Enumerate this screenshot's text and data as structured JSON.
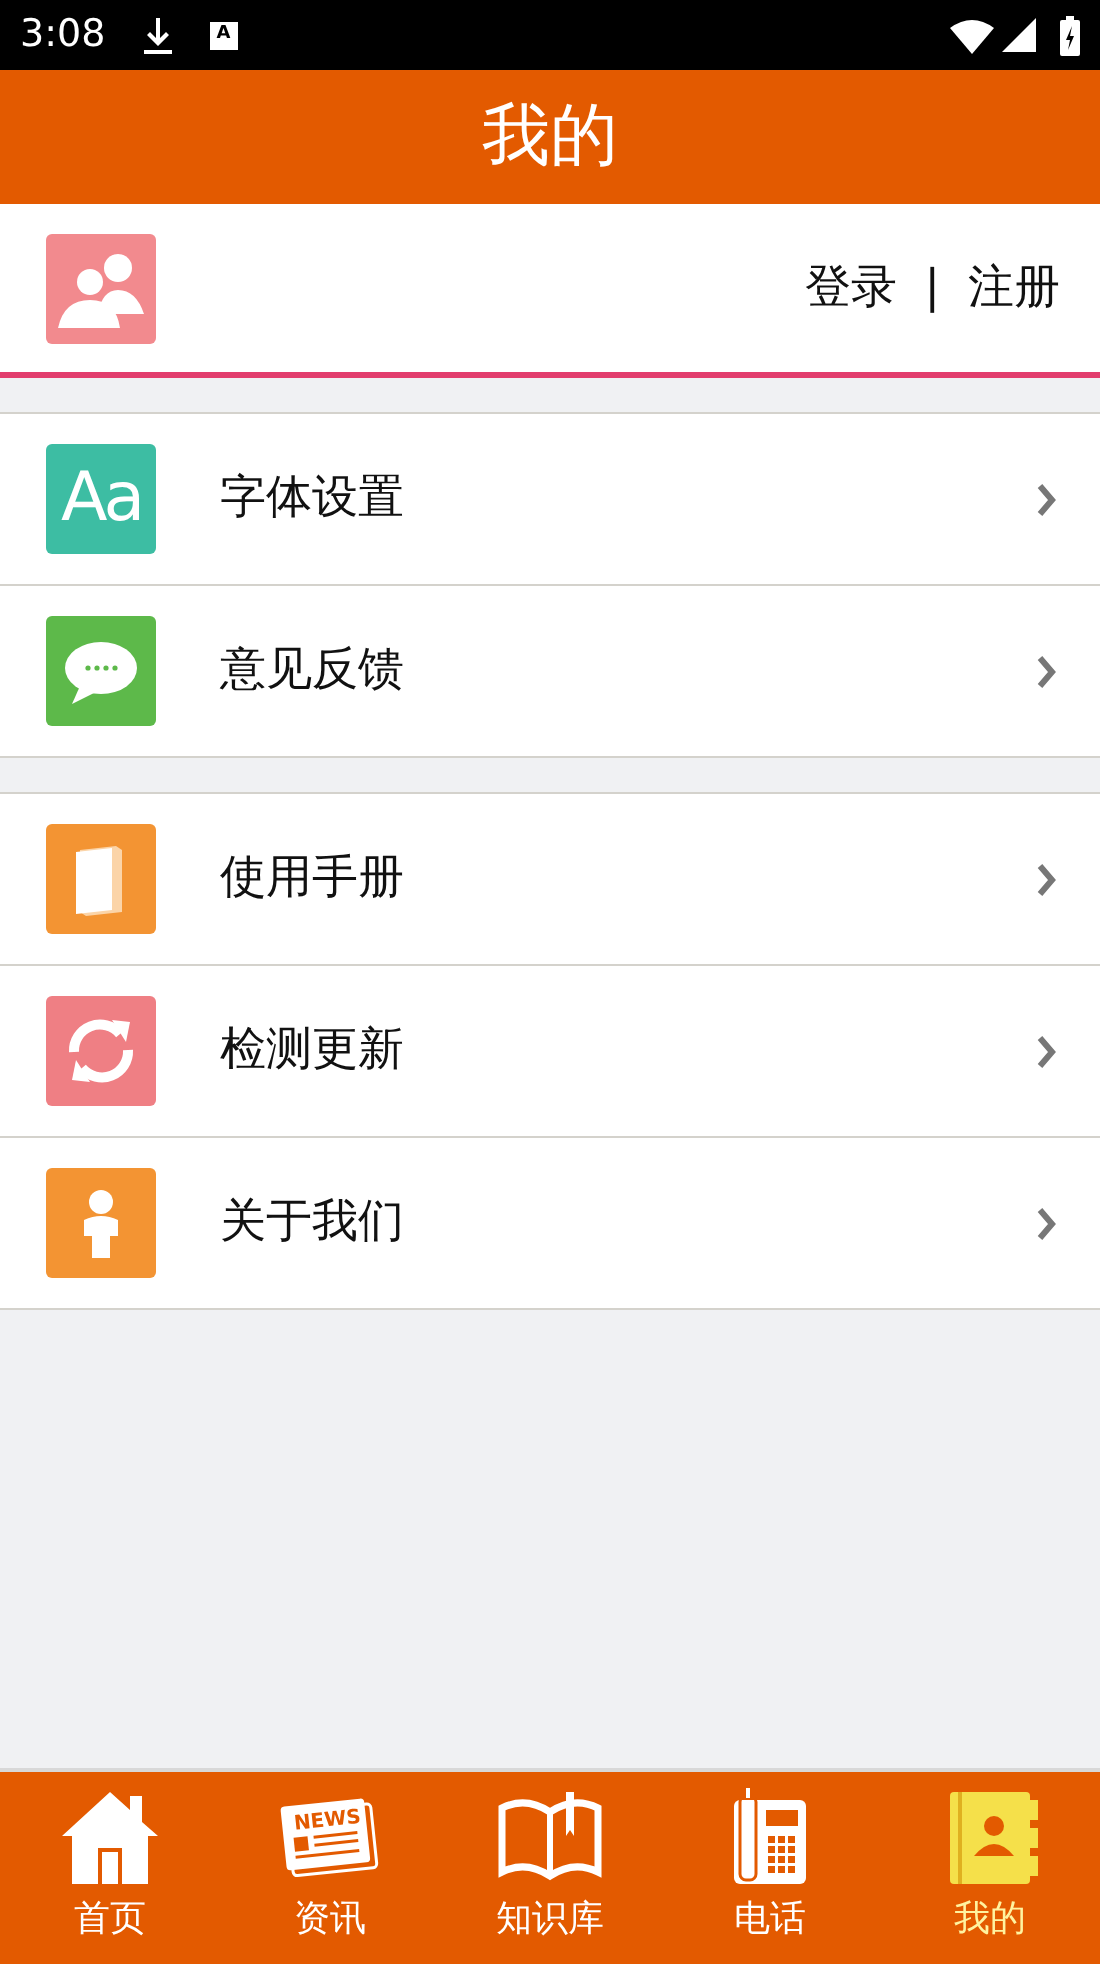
{
  "status_bar": {
    "time": "3:08",
    "notification_letter": "A"
  },
  "header": {
    "title": "我的"
  },
  "profile": {
    "login": "登录",
    "separator": "|",
    "register": "注册"
  },
  "menu_groups": [
    {
      "items": [
        {
          "label": "字体设置",
          "icon_text": "Aa"
        },
        {
          "label": "意见反馈"
        }
      ]
    },
    {
      "items": [
        {
          "label": "使用手册"
        },
        {
          "label": "检测更新"
        },
        {
          "label": "关于我们"
        }
      ]
    }
  ],
  "tab_bar": [
    {
      "label": "首页",
      "selected": false
    },
    {
      "label": "资讯",
      "selected": false,
      "icon_text": "NEWS"
    },
    {
      "label": "知识库",
      "selected": false
    },
    {
      "label": "电话",
      "selected": false
    },
    {
      "label": "我的",
      "selected": true
    }
  ]
}
